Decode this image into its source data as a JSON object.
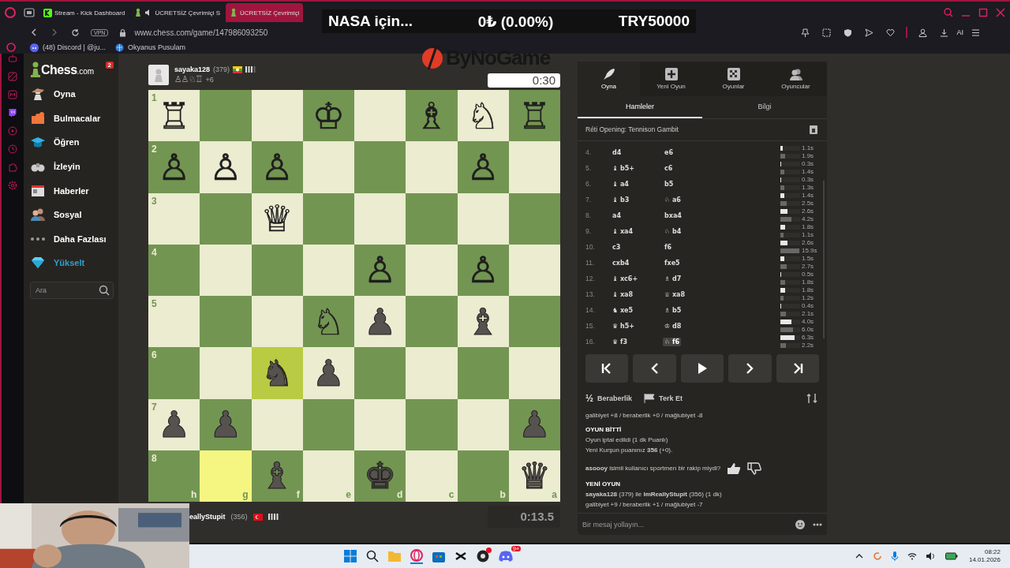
{
  "browser": {
    "tabs": [
      {
        "title": "Stream - Kick Dashboard",
        "kind": "kick",
        "selected": false
      },
      {
        "title": "ÜCRETSİZ Çevrimiçi S",
        "kind": "chess-audio",
        "selected": false
      },
      {
        "title": "ÜCRETSİZ Çevrimiçi",
        "kind": "chess",
        "selected": true
      }
    ],
    "vpn": "VPN",
    "url": "www.chess.com/game/147986093250",
    "ai": "AI",
    "bookmarks": [
      {
        "title": "(48) Discord | @ju...",
        "kind": "discord"
      },
      {
        "title": "Okyanus Pusulam",
        "kind": "globe"
      }
    ]
  },
  "ticker": {
    "name": "NASA için...",
    "change": "0₺ (0.00%)",
    "price": "TRY50000"
  },
  "overlay_logo": "ByNoGame",
  "sidebar": {
    "logo": "Chess",
    "logo_suffix": ".com",
    "badge": "2",
    "items": [
      {
        "label": "Oyna",
        "kind": "play"
      },
      {
        "label": "Bulmacalar",
        "kind": "puzzle"
      },
      {
        "label": "Öğren",
        "kind": "learn"
      },
      {
        "label": "İzleyin",
        "kind": "watch"
      },
      {
        "label": "Haberler",
        "kind": "news"
      },
      {
        "label": "Sosyal",
        "kind": "social"
      },
      {
        "label": "Daha Fazlası",
        "kind": "more"
      },
      {
        "label": "Yükselt",
        "kind": "upgrade"
      }
    ],
    "search": {
      "placeholder": "Ara"
    }
  },
  "top_player": {
    "name": "sayaka128",
    "rating": "(379)",
    "captured": "♙♙♘♖",
    "advantage": "+6",
    "clock": "0:30"
  },
  "board": {
    "ranks": [
      "1",
      "2",
      "3",
      "4",
      "5",
      "6",
      "7",
      "8"
    ],
    "files": [
      "h",
      "g",
      "f",
      "e",
      "d",
      "c",
      "b",
      "a"
    ],
    "rows": [
      [
        {
          "piece": "♖",
          "kind": "white",
          "highlighted": false
        },
        {
          "highlighted": false
        },
        {
          "highlighted": false
        },
        {
          "piece": "♔",
          "kind": "white",
          "highlighted": false
        },
        {
          "highlighted": false
        },
        {
          "piece": "♗",
          "kind": "white",
          "highlighted": false
        },
        {
          "piece": "♘",
          "kind": "white",
          "highlighted": false
        },
        {
          "piece": "♖",
          "kind": "white",
          "highlighted": false
        }
      ],
      [
        {
          "piece": "♙",
          "kind": "white",
          "highlighted": false
        },
        {
          "piece": "♙",
          "kind": "white",
          "highlighted": false
        },
        {
          "piece": "♙",
          "kind": "white",
          "highlighted": false
        },
        {
          "highlighted": false
        },
        {
          "highlighted": false
        },
        {
          "highlighted": false
        },
        {
          "piece": "♙",
          "kind": "white",
          "highlighted": false
        },
        {
          "highlighted": false
        }
      ],
      [
        {
          "highlighted": false
        },
        {
          "highlighted": false
        },
        {
          "piece": "♕",
          "kind": "white",
          "highlighted": false
        },
        {
          "highlighted": false
        },
        {
          "highlighted": false
        },
        {
          "highlighted": false
        },
        {
          "highlighted": false
        },
        {
          "highlighted": false
        }
      ],
      [
        {
          "highlighted": false
        },
        {
          "highlighted": false
        },
        {
          "highlighted": false
        },
        {
          "highlighted": false
        },
        {
          "piece": "♙",
          "kind": "white",
          "highlighted": false
        },
        {
          "highlighted": false
        },
        {
          "piece": "♙",
          "kind": "white",
          "highlighted": false
        },
        {
          "highlighted": false
        }
      ],
      [
        {
          "highlighted": false
        },
        {
          "highlighted": false
        },
        {
          "highlighted": false
        },
        {
          "piece": "♘",
          "kind": "white",
          "highlighted": false
        },
        {
          "piece": "♟",
          "kind": "black",
          "highlighted": false
        },
        {
          "highlighted": false
        },
        {
          "piece": "♝",
          "kind": "black",
          "highlighted": false
        },
        {
          "highlighted": false
        }
      ],
      [
        {
          "highlighted": false
        },
        {
          "highlighted": false
        },
        {
          "piece": "♞",
          "kind": "black",
          "highlighted": true
        },
        {
          "piece": "♟",
          "kind": "black",
          "highlighted": false
        },
        {
          "highlighted": false
        },
        {
          "highlighted": false
        },
        {
          "highlighted": false
        },
        {
          "highlighted": false
        }
      ],
      [
        {
          "piece": "♟",
          "kind": "black",
          "highlighted": false
        },
        {
          "piece": "♟",
          "kind": "black",
          "highlighted": false
        },
        {
          "highlighted": false
        },
        {
          "highlighted": false
        },
        {
          "highlighted": false
        },
        {
          "highlighted": false
        },
        {
          "highlighted": false
        },
        {
          "piece": "♟",
          "kind": "black",
          "highlighted": false
        }
      ],
      [
        {
          "highlighted": false
        },
        {
          "highlighted": true
        },
        {
          "piece": "♝",
          "kind": "black",
          "highlighted": false
        },
        {
          "highlighted": false
        },
        {
          "piece": "♚",
          "kind": "black",
          "highlighted": false
        },
        {
          "highlighted": false
        },
        {
          "highlighted": false
        },
        {
          "piece": "♛",
          "kind": "black",
          "highlighted": false
        }
      ]
    ]
  },
  "bottom_player": {
    "name": "eallyStupit",
    "rating": "(356)",
    "clock": "0:13.5"
  },
  "panel": {
    "tabs": [
      {
        "label": "Oyna",
        "kind": "play",
        "selected": true
      },
      {
        "label": "Yeni Oyun",
        "kind": "new",
        "selected": false
      },
      {
        "label": "Oyunlar",
        "kind": "games",
        "selected": false
      },
      {
        "label": "Oyuncular",
        "kind": "players",
        "selected": false
      }
    ],
    "subtabs": [
      {
        "label": "Hamleler",
        "selected": true
      },
      {
        "label": "Bilgi",
        "selected": false
      }
    ],
    "opening": "Réti Opening: Tennison Gambit",
    "moves": [
      {
        "number": "4.",
        "white": {
          "move": "d4",
          "time": "1.1s",
          "level": 0.12,
          "selected": false
        },
        "black": {
          "move": "e6",
          "time": "1.9s",
          "level": 0.24,
          "selected": false
        }
      },
      {
        "number": "5.",
        "white": {
          "move": "♝ b5+",
          "time": "0.3s",
          "level": 0.04,
          "selected": false
        },
        "black": {
          "move": "c6",
          "time": "1.4s",
          "level": 0.2,
          "selected": false
        }
      },
      {
        "number": "6.",
        "white": {
          "move": "♝ a4",
          "time": "0.3s",
          "level": 0.04,
          "selected": false
        },
        "black": {
          "move": "b5",
          "time": "1.3s",
          "level": 0.2,
          "selected": false
        }
      },
      {
        "number": "7.",
        "white": {
          "move": "♝ b3",
          "time": "1.4s",
          "level": 0.2,
          "selected": false
        },
        "black": {
          "move": "♘ a6",
          "time": "2.5s",
          "level": 0.32,
          "selected": false
        }
      },
      {
        "number": "8.",
        "white": {
          "move": "a4",
          "time": "2.6s",
          "level": 0.36,
          "selected": false
        },
        "black": {
          "move": "bxa4",
          "time": "4.2s",
          "level": 0.56,
          "selected": false
        }
      },
      {
        "number": "9.",
        "white": {
          "move": "♝ xa4",
          "time": "1.8s",
          "level": 0.24,
          "selected": false
        },
        "black": {
          "move": "♘ b4",
          "time": "1.1s",
          "level": 0.16,
          "selected": false
        }
      },
      {
        "number": "10.",
        "white": {
          "move": "c3",
          "time": "2.6s",
          "level": 0.36,
          "selected": false
        },
        "black": {
          "move": "f6",
          "time": "15.9s",
          "level": 0.96,
          "selected": false
        }
      },
      {
        "number": "11.",
        "white": {
          "move": "cxb4",
          "time": "1.5s",
          "level": 0.2,
          "selected": false
        },
        "black": {
          "move": "fxe5",
          "time": "2.7s",
          "level": 0.32,
          "selected": false
        }
      },
      {
        "number": "12.",
        "white": {
          "move": "♝ xc6+",
          "time": "0.5s",
          "level": 0.04,
          "selected": false
        },
        "black": {
          "move": "♗ d7",
          "time": "1.8s",
          "level": 0.24,
          "selected": false
        }
      },
      {
        "number": "13.",
        "white": {
          "move": "♝ xa8",
          "time": "1.8s",
          "level": 0.24,
          "selected": false
        },
        "black": {
          "move": "♕ xa8",
          "time": "1.2s",
          "level": 0.16,
          "selected": false
        }
      },
      {
        "number": "14.",
        "white": {
          "move": "♞ xe5",
          "time": "0.4s",
          "level": 0.04,
          "selected": false
        },
        "black": {
          "move": "♗ b5",
          "time": "2.1s",
          "level": 0.28,
          "selected": false
        }
      },
      {
        "number": "15.",
        "white": {
          "move": "♛ h5+",
          "time": "4.0s",
          "level": 0.56,
          "selected": false
        },
        "black": {
          "move": "♔ d8",
          "time": "6.0s",
          "level": 0.64,
          "selected": false
        }
      },
      {
        "number": "16.",
        "white": {
          "move": "♛ f3",
          "time": "6.3s",
          "level": 0.72,
          "selected": false
        },
        "black": {
          "move": "♘ f6",
          "time": "2.2s",
          "level": 0.28,
          "selected": true
        }
      }
    ],
    "draw_glyph": "½",
    "draw": "Beraberlik",
    "resign": "Terk Et",
    "chat": [
      {
        "kind": "line",
        "text": "galibiyet +8 / beraberlik +0 / mağlubiyet -8"
      },
      {
        "kind": "heading",
        "text": "OYUN BİTTİ"
      },
      {
        "kind": "line",
        "text": "Oyun iptal edildi (1 dk Puanlı)"
      },
      {
        "kind": "line",
        "text": "Yeni Kurşun puanınız **356** (+0)."
      },
      {
        "kind": "feedback",
        "text": "**asoooy** isimli kullanıcı sportmen bir rakip miydi?"
      },
      {
        "kind": "heading",
        "text": "YENİ OYUN"
      },
      {
        "kind": "line",
        "text": "**sayaka128** (379) ile **ImReallyStupit** (356) (1 dk)"
      },
      {
        "kind": "line",
        "text": "galibiyet +9 / beraberlik +1 / mağlubiyet -7"
      }
    ],
    "chat_placeholder": "Bir mesaj yollayın..."
  },
  "taskbar": {
    "discord_badge": "9+",
    "time": "08:22",
    "date": "14.01.2026"
  }
}
